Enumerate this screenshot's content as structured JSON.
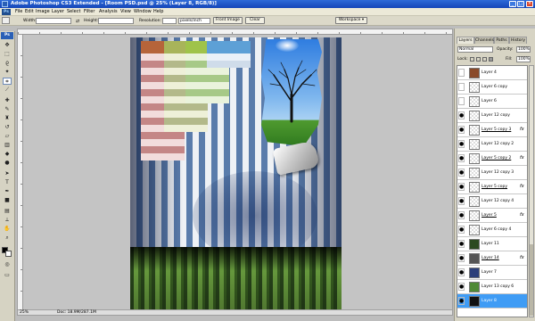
{
  "window": {
    "title": "Adobe Photoshop CS3 Extended - [Room PSD.psd @ 25% (Layer 8, RGB/8)]",
    "buttons": [
      "_",
      "□",
      "×"
    ]
  },
  "menu": {
    "items": [
      "File",
      "Edit",
      "Image",
      "Layer",
      "Select",
      "Filter",
      "Analysis",
      "View",
      "Window",
      "Help"
    ]
  },
  "options": {
    "width_label": "Width:",
    "height_label": "Height:",
    "resolution_label": "Resolution:",
    "resolution_unit": "pixels/inch",
    "front_image": "Front Image",
    "clear": "Clear",
    "workspace": "Workspace ▾"
  },
  "status": {
    "zoom": "25%",
    "doc": "Doc: 18.9M/287.1M"
  },
  "layers_panel": {
    "tabs": [
      "Layers",
      "Channels",
      "Paths",
      "History"
    ],
    "blend_mode": "Normal",
    "opacity_label": "Opacity:",
    "opacity_value": "100%",
    "lock_label": "Lock:",
    "fill_label": "Fill:",
    "fill_value": "100%",
    "layers": [
      {
        "name": "Layer 4",
        "visible": false,
        "fx": false
      },
      {
        "name": "Layer 6 copy",
        "visible": false,
        "fx": false
      },
      {
        "name": "Layer 6",
        "visible": false,
        "fx": false
      },
      {
        "name": "Layer 12 copy",
        "visible": true,
        "fx": false
      },
      {
        "name": "Layer 5 copy 3",
        "visible": true,
        "fx": true
      },
      {
        "name": "Layer 12 copy 2",
        "visible": true,
        "fx": false
      },
      {
        "name": "Layer 5 copy 2",
        "visible": true,
        "fx": true
      },
      {
        "name": "Layer 12 copy 3",
        "visible": true,
        "fx": false
      },
      {
        "name": "Layer 5 copy",
        "visible": true,
        "fx": true
      },
      {
        "name": "Layer 12 copy 4",
        "visible": true,
        "fx": false
      },
      {
        "name": "Layer 5",
        "visible": true,
        "fx": true
      },
      {
        "name": "Layer 6 copy 4",
        "visible": true,
        "fx": false
      },
      {
        "name": "Layer 11",
        "visible": true,
        "fx": false
      },
      {
        "name": "Layer 14",
        "visible": true,
        "fx": true
      },
      {
        "name": "Layer 7",
        "visible": true,
        "fx": false
      },
      {
        "name": "Layer 13 copy 6",
        "visible": true,
        "fx": false
      },
      {
        "name": "Layer 8",
        "visible": true,
        "fx": false,
        "selected": true
      }
    ]
  }
}
